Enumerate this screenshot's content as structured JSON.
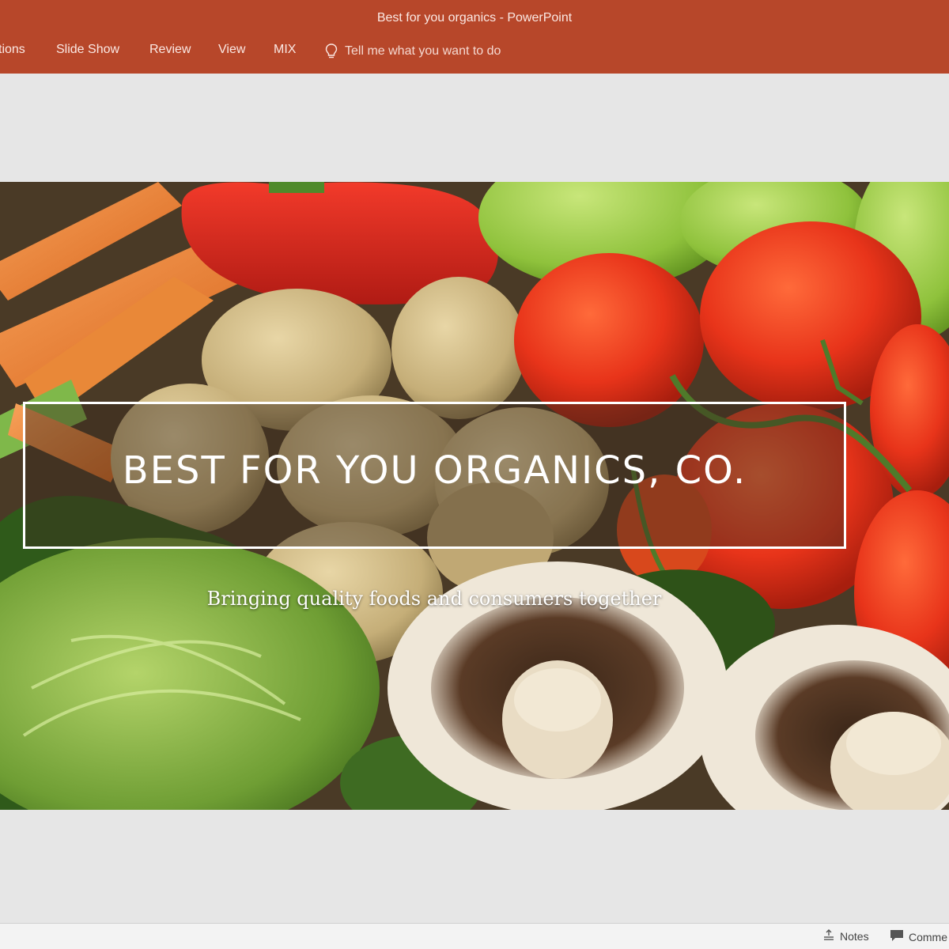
{
  "app": {
    "window_title": "Best for you organics - PowerPoint"
  },
  "ribbon": {
    "tabs": [
      {
        "label": "tions"
      },
      {
        "label": "Slide Show"
      },
      {
        "label": "Review"
      },
      {
        "label": "View"
      },
      {
        "label": "MIX"
      }
    ],
    "tell_me": {
      "icon": "lightbulb-icon",
      "label": "Tell me what you want to do"
    }
  },
  "slide": {
    "title": "BEST FOR YOU ORGANICS, CO.",
    "subtitle": "Bringing quality foods and consumers together",
    "background": "vegetables photo: carrots, red pepper, potatoes, green apples, tomatoes, cabbage, mushrooms"
  },
  "statusbar": {
    "notes_label": "Notes",
    "comments_label": "Comme",
    "notes_icon": "notes-icon",
    "comments_icon": "comment-icon"
  },
  "colors": {
    "accent": "#b7472a",
    "workspace": "#e6e6e6",
    "statusbar": "#f3f3f3"
  }
}
